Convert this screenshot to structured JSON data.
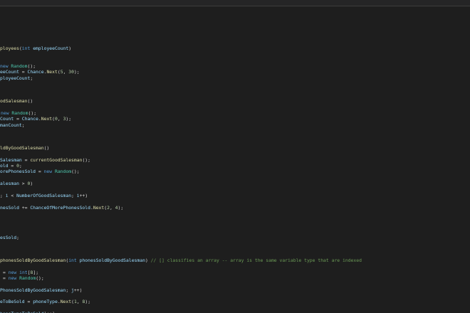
{
  "colors": {
    "background": "#1e1e1e",
    "plain": "#d4d4d4",
    "keyword": "#569cd6",
    "type": "#4ec9b0",
    "function": "#dcdcaa",
    "variable": "#9cdcfe",
    "number": "#b5cea8",
    "comment": "#6a9955"
  },
  "code_lines": [
    {
      "tokens": [
        {
          "t": "ployees",
          "c": "fn"
        },
        {
          "t": "(",
          "c": "plain"
        },
        {
          "t": "int",
          "c": "kw"
        },
        {
          "t": " ",
          "c": "plain"
        },
        {
          "t": "employeeCount",
          "c": "var"
        },
        {
          "t": ")",
          "c": "plain"
        }
      ]
    },
    {
      "tokens": [
        {
          "t": "new",
          "c": "kw"
        },
        {
          "t": " ",
          "c": "plain"
        },
        {
          "t": "Random",
          "c": "type"
        },
        {
          "t": "();",
          "c": "plain"
        }
      ]
    },
    {
      "tokens": [
        {
          "t": "eeCount",
          "c": "var"
        },
        {
          "t": " = ",
          "c": "plain"
        },
        {
          "t": "Chance",
          "c": "var"
        },
        {
          "t": ".",
          "c": "plain"
        },
        {
          "t": "Next",
          "c": "fn"
        },
        {
          "t": "(",
          "c": "plain"
        },
        {
          "t": "5",
          "c": "num"
        },
        {
          "t": ", ",
          "c": "plain"
        },
        {
          "t": "30",
          "c": "num"
        },
        {
          "t": ");",
          "c": "plain"
        }
      ]
    },
    {
      "tokens": [
        {
          "t": "ployeeCount",
          "c": "var"
        },
        {
          "t": ";",
          "c": "plain"
        }
      ]
    },
    {
      "tokens": [
        {
          "t": "odSalesman",
          "c": "fn"
        },
        {
          "t": "()",
          "c": "plain"
        }
      ]
    },
    {
      "tokens": [
        {
          "t": "new",
          "c": "kw"
        },
        {
          "t": " ",
          "c": "plain"
        },
        {
          "t": "Random",
          "c": "type"
        },
        {
          "t": "();",
          "c": "plain"
        }
      ]
    },
    {
      "tokens": [
        {
          "t": "Count",
          "c": "var"
        },
        {
          "t": " = ",
          "c": "plain"
        },
        {
          "t": "Chance",
          "c": "var"
        },
        {
          "t": ".",
          "c": "plain"
        },
        {
          "t": "Next",
          "c": "fn"
        },
        {
          "t": "(",
          "c": "plain"
        },
        {
          "t": "0",
          "c": "num"
        },
        {
          "t": ", ",
          "c": "plain"
        },
        {
          "t": "3",
          "c": "num"
        },
        {
          "t": ");",
          "c": "plain"
        }
      ]
    },
    {
      "tokens": [
        {
          "t": "manCount",
          "c": "var"
        },
        {
          "t": ";",
          "c": "plain"
        }
      ]
    },
    {
      "tokens": [
        {
          "t": "ldByGoodSalesman",
          "c": "fn"
        },
        {
          "t": "()",
          "c": "plain"
        }
      ]
    },
    {
      "tokens": [
        {
          "t": "Salesman",
          "c": "var"
        },
        {
          "t": " = ",
          "c": "plain"
        },
        {
          "t": "currentGoodSalesman",
          "c": "fn"
        },
        {
          "t": "();",
          "c": "plain"
        }
      ]
    },
    {
      "tokens": [
        {
          "t": "old",
          "c": "var"
        },
        {
          "t": " = ",
          "c": "plain"
        },
        {
          "t": "0",
          "c": "num"
        },
        {
          "t": ";",
          "c": "plain"
        }
      ]
    },
    {
      "tokens": [
        {
          "t": "orePhonesSold",
          "c": "var"
        },
        {
          "t": " = ",
          "c": "plain"
        },
        {
          "t": "new",
          "c": "kw"
        },
        {
          "t": " ",
          "c": "plain"
        },
        {
          "t": "Random",
          "c": "type"
        },
        {
          "t": "();",
          "c": "plain"
        }
      ]
    },
    {
      "tokens": [
        {
          "t": "alesman",
          "c": "var"
        },
        {
          "t": " > ",
          "c": "plain"
        },
        {
          "t": "0",
          "c": "num"
        },
        {
          "t": ")",
          "c": "plain"
        }
      ]
    },
    {
      "tokens": [
        {
          "t": "; ",
          "c": "plain"
        },
        {
          "t": "i",
          "c": "var"
        },
        {
          "t": " < ",
          "c": "plain"
        },
        {
          "t": "NumberOfGoodSalesman",
          "c": "var"
        },
        {
          "t": "; ",
          "c": "plain"
        },
        {
          "t": "i",
          "c": "var"
        },
        {
          "t": "++)",
          "c": "plain"
        }
      ]
    },
    {
      "tokens": [
        {
          "t": "nesSold",
          "c": "var"
        },
        {
          "t": " += ",
          "c": "plain"
        },
        {
          "t": "ChanceOfMorePhonesSold",
          "c": "var"
        },
        {
          "t": ".",
          "c": "plain"
        },
        {
          "t": "Next",
          "c": "fn"
        },
        {
          "t": "(",
          "c": "plain"
        },
        {
          "t": "2",
          "c": "num"
        },
        {
          "t": ", ",
          "c": "plain"
        },
        {
          "t": "4",
          "c": "num"
        },
        {
          "t": ");",
          "c": "plain"
        }
      ]
    },
    {
      "tokens": [
        {
          "t": "esSold",
          "c": "var"
        },
        {
          "t": ";",
          "c": "plain"
        }
      ]
    },
    {
      "tokens": [
        {
          "t": "phonesSoldByGoodSalesman",
          "c": "fn"
        },
        {
          "t": "(",
          "c": "plain"
        },
        {
          "t": "int",
          "c": "kw"
        },
        {
          "t": " ",
          "c": "plain"
        },
        {
          "t": "phonesSoldByGoodSalesman",
          "c": "var"
        },
        {
          "t": ") ",
          "c": "plain"
        },
        {
          "t": "// [] classifies an array -- array is the same variable type that are indexed",
          "c": "cm"
        }
      ]
    },
    {
      "tokens": [
        {
          "t": "= ",
          "c": "plain"
        },
        {
          "t": "new",
          "c": "kw"
        },
        {
          "t": " ",
          "c": "plain"
        },
        {
          "t": "int",
          "c": "kw"
        },
        {
          "t": "[",
          "c": "plain"
        },
        {
          "t": "8",
          "c": "num"
        },
        {
          "t": "];",
          "c": "plain"
        }
      ]
    },
    {
      "tokens": [
        {
          "t": "= ",
          "c": "plain"
        },
        {
          "t": "new",
          "c": "kw"
        },
        {
          "t": " ",
          "c": "plain"
        },
        {
          "t": "Random",
          "c": "type"
        },
        {
          "t": "();",
          "c": "plain"
        }
      ]
    },
    {
      "tokens": [
        {
          "t": "PhonesSoldByGoodSalesman",
          "c": "var"
        },
        {
          "t": "; ",
          "c": "plain"
        },
        {
          "t": "j",
          "c": "var"
        },
        {
          "t": "++)",
          "c": "plain"
        }
      ]
    },
    {
      "tokens": [
        {
          "t": "eToBeSold",
          "c": "var"
        },
        {
          "t": " = ",
          "c": "plain"
        },
        {
          "t": "phoneType",
          "c": "var"
        },
        {
          "t": ".",
          "c": "plain"
        },
        {
          "t": "Next",
          "c": "fn"
        },
        {
          "t": "(",
          "c": "plain"
        },
        {
          "t": "1",
          "c": "num"
        },
        {
          "t": ", ",
          "c": "plain"
        },
        {
          "t": "8",
          "c": "num"
        },
        {
          "t": ");",
          "c": "plain"
        }
      ]
    },
    {
      "tokens": [
        {
          "t": "honeTypeToBeSold",
          "c": "var"
        },
        {
          "t": "]++",
          "c": "plain"
        },
        {
          "t": "];",
          "c": "plain"
        }
      ]
    }
  ]
}
